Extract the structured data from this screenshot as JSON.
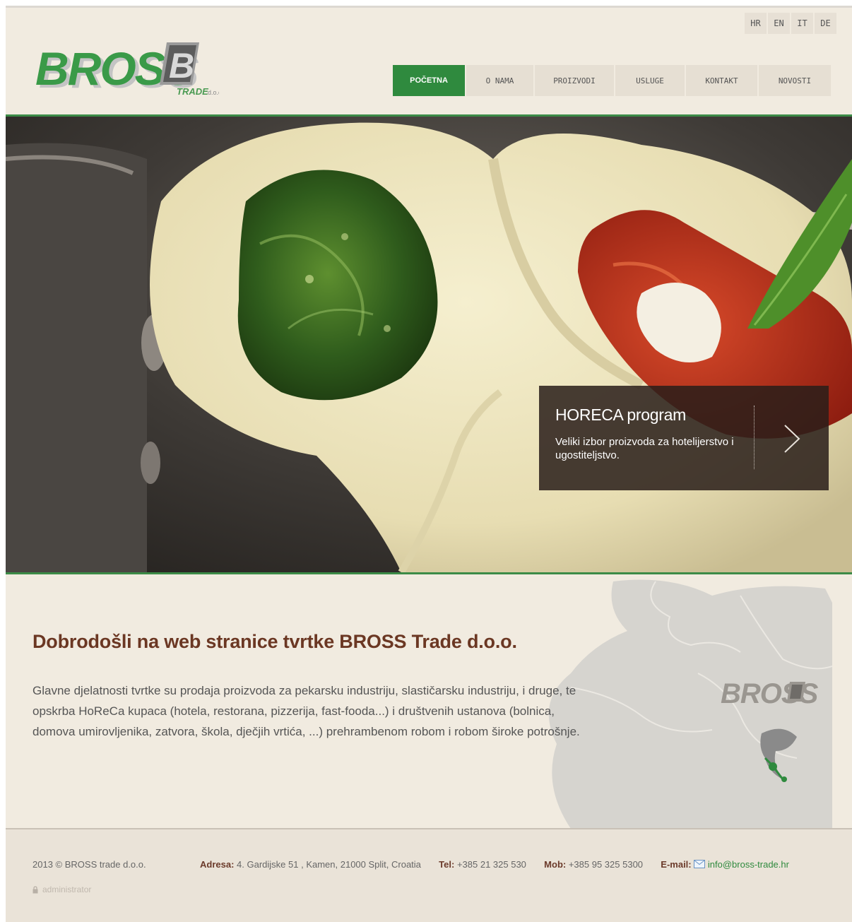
{
  "brand": {
    "name": "BROSS",
    "mark_letter": "B",
    "sub": "TRADE",
    "suffix": "d.o.o"
  },
  "languages": [
    "HR",
    "EN",
    "IT",
    "DE"
  ],
  "nav": {
    "items": [
      "POČETNA",
      "O NAMA",
      "PROIZVODI",
      "USLUGE",
      "KONTAKT",
      "NOVOSTI"
    ],
    "active": "POČETNA"
  },
  "slide": {
    "title": "HORECA program",
    "text": "Veliki izbor proizvoda za hotelijerstvo i ugostiteljstvo."
  },
  "welcome": {
    "title": "Dobrodošli na web stranice tvrtke BROSS Trade d.o.o.",
    "text": "Glavne djelatnosti tvrtke su prodaja proizvoda za pekarsku industriju, slastičarsku industriju, i druge, te opskrba HoReCa kupaca (hotela, restorana, pizzerija, fast-fooda...) i društvenih ustanova (bolnica, domova umirovljenika, zatvora, škola, dječjih vrtića, ...) prehrambenom robom i robom široke potrošnje."
  },
  "map": {
    "brand": "BROSS"
  },
  "footer": {
    "copyright": "2013 © BROSS trade d.o.o.",
    "admin": "administrator",
    "address_label": "Adresa:",
    "address": "4. Gardijske 51 , Kamen,  21000 Split, Croatia",
    "tel_label": "Tel:",
    "tel": "+385 21 325 530",
    "mob_label": "Mob:",
    "mob": "+385 95 325 5300",
    "email_label": "E-mail:",
    "email": "info@bross-trade.hr"
  },
  "colors": {
    "accent": "#2f8a3e",
    "page_bg": "#f1ebe0",
    "heading": "#6b3723"
  }
}
